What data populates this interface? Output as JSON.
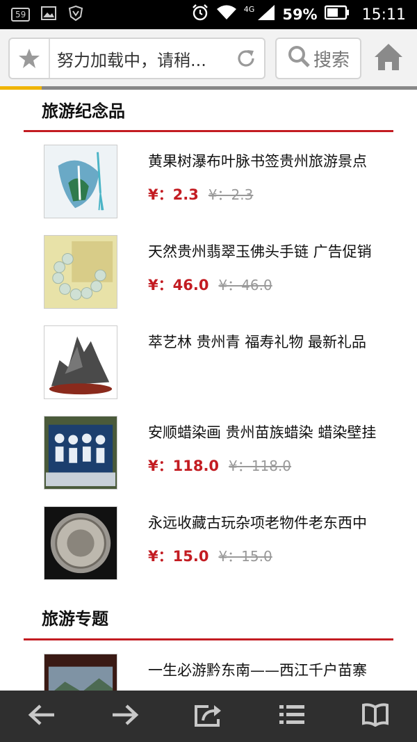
{
  "status_bar": {
    "notification_count": "59",
    "network": "4G",
    "battery_percent": "59%",
    "time": "15:11"
  },
  "toolbar": {
    "url_text": "努力加载中，请稍...",
    "search_label": "搜索",
    "progress": 0.1
  },
  "sections": [
    {
      "title": "旅游纪念品",
      "items": [
        {
          "title": "黄果树瀑布叶脉书签贵州旅游景点",
          "price": "¥：2.3",
          "old_price": "¥：2.3"
        },
        {
          "title": "天然贵州翡翠玉佛头手链 广告促销",
          "price": "¥：46.0",
          "old_price": "¥：46.0"
        },
        {
          "title": "萃艺林 贵州青 福寿礼物 最新礼品",
          "price": "",
          "old_price": ""
        },
        {
          "title": "安顺蜡染画 贵州苗族蜡染 蜡染壁挂",
          "price": "¥：118.0",
          "old_price": "¥：118.0"
        },
        {
          "title": "永远收藏古玩杂项老物件老东西中",
          "price": "¥：15.0",
          "old_price": "¥：15.0"
        }
      ]
    },
    {
      "title": "旅游专题",
      "items": [
        {
          "title": "一生必游黔东南——西江千户苗寨"
        }
      ]
    }
  ],
  "bottom_nav": [
    "back-arrow-icon",
    "forward-arrow-icon",
    "share-icon",
    "menu-icon",
    "bookmarks-icon"
  ],
  "colors": {
    "accent": "#c31c22",
    "progress": "#f0b400",
    "bottom_bar": "#2f2f2f"
  }
}
